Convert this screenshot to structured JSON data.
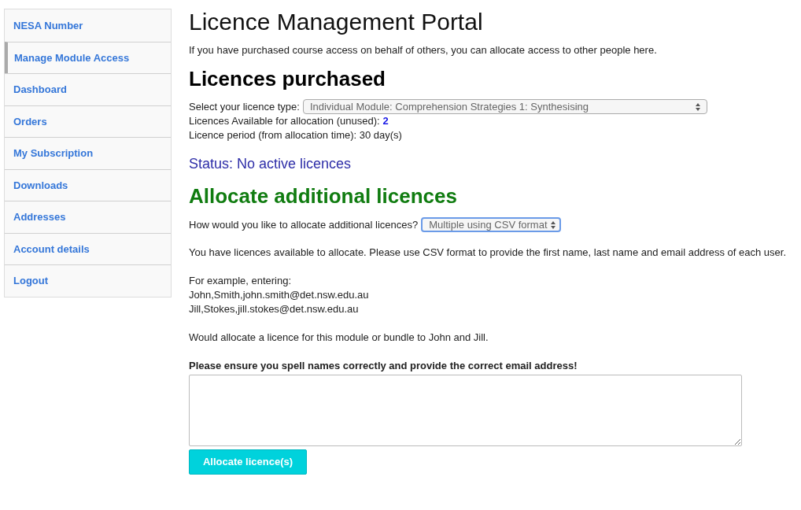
{
  "sidebar": {
    "items": [
      {
        "label": "NESA Number",
        "selected": false
      },
      {
        "label": "Manage Module Access",
        "selected": true
      },
      {
        "label": "Dashboard",
        "selected": false
      },
      {
        "label": "Orders",
        "selected": false
      },
      {
        "label": "My Subscription",
        "selected": false
      },
      {
        "label": "Downloads",
        "selected": false
      },
      {
        "label": "Addresses",
        "selected": false
      },
      {
        "label": "Account details",
        "selected": false
      },
      {
        "label": "Logout",
        "selected": false
      }
    ]
  },
  "title": "Licence Management Portal",
  "intro": "If you have purchased course access on behalf of others, you can allocate access to other people here.",
  "purchased": {
    "heading": "Licences purchased",
    "type_label": "Select your licence type:",
    "type_value": "Individual Module: Comprehension Strategies 1: Synthesising",
    "type_focused": false,
    "available_label": "Licences Available for allocation (unused):",
    "available_value": "2",
    "period": "Licence period (from allocation time): 30 day(s)",
    "status": "Status: No active licences"
  },
  "allocate": {
    "heading": "Allocate additional licences",
    "method_label": "How would you like to allocate additional licences?",
    "method_value": "Multiple using CSV format",
    "method_focused": true,
    "info": "You have licences available to allocate. Please use CSV format to provide the first name, last name and email address of each user.",
    "example_intro": "For example, entering:",
    "example_lines": [
      "John,Smith,john.smith@det.nsw.edu.au",
      "Jill,Stokes,jill.stokes@det.nsw.edu.au"
    ],
    "example_outro": "Would allocate a licence for this module or bundle to John and Jill.",
    "warning": "Please ensure you spell names correctly and provide the correct email address!",
    "button": "Allocate licence(s)"
  }
}
